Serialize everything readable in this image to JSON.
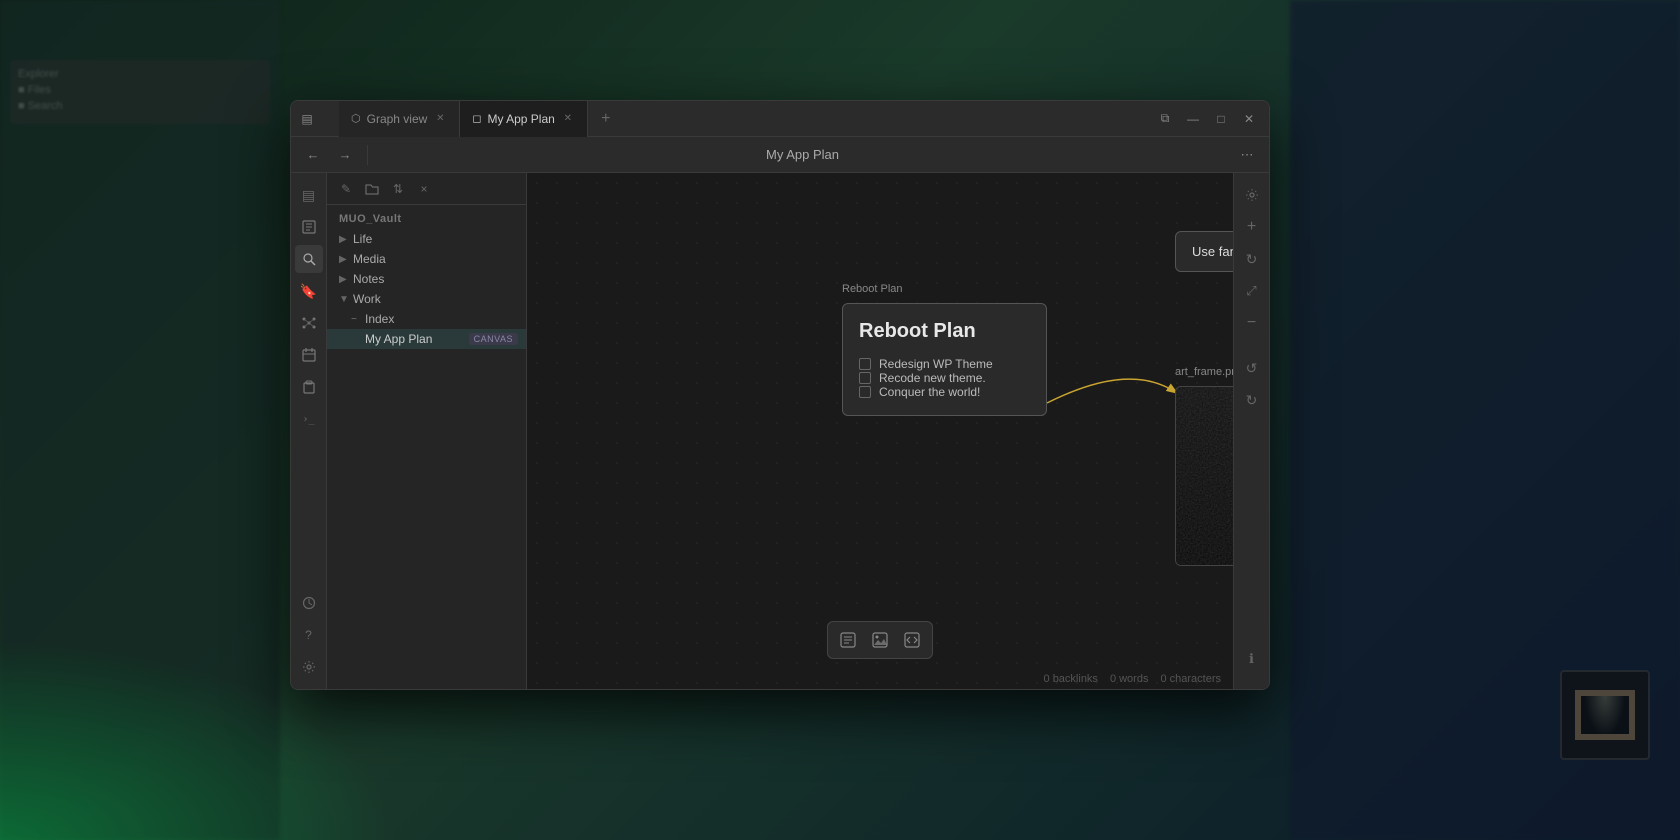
{
  "desktop": {
    "bg_color": "#1a3a2a"
  },
  "window": {
    "title": "My App Plan",
    "tabs": [
      {
        "id": "graph",
        "label": "Graph view",
        "icon": "⬡",
        "active": false
      },
      {
        "id": "canvas",
        "label": "My App Plan",
        "icon": "◻",
        "active": true
      }
    ],
    "tab_add_label": "+",
    "toolbar": {
      "back_label": "←",
      "forward_label": "→",
      "title": "My App Plan",
      "more_label": "⋯"
    },
    "win_controls": {
      "split": "⧉",
      "minimize": "—",
      "maximize": "□",
      "close": "✕"
    }
  },
  "sidebar_icons": [
    {
      "id": "sidebar-toggle",
      "icon": "▤",
      "title": "Toggle sidebar"
    },
    {
      "id": "files",
      "icon": "📁",
      "title": "Files"
    },
    {
      "id": "search",
      "icon": "🔍",
      "title": "Search"
    },
    {
      "id": "bookmark",
      "icon": "🔖",
      "title": "Bookmarks"
    },
    {
      "id": "graph-view",
      "icon": "⬡",
      "title": "Graph view"
    },
    {
      "id": "calendar",
      "icon": "📅",
      "title": "Calendar"
    },
    {
      "id": "clipboard",
      "icon": "📋",
      "title": "Clipboard"
    },
    {
      "id": "terminal",
      "icon": ">_",
      "title": "Terminal"
    }
  ],
  "sidebar_icons_bottom": [
    {
      "id": "publish",
      "icon": "☁",
      "title": "Publish"
    },
    {
      "id": "help",
      "icon": "?",
      "title": "Help"
    },
    {
      "id": "settings",
      "icon": "⚙",
      "title": "Settings"
    }
  ],
  "file_explorer": {
    "toolbar_buttons": [
      {
        "id": "new-note",
        "icon": "✎",
        "title": "New note"
      },
      {
        "id": "new-folder",
        "icon": "📁",
        "title": "New folder"
      },
      {
        "id": "sort",
        "icon": "⇅",
        "title": "Sort"
      },
      {
        "id": "collapse",
        "icon": "×",
        "title": "Collapse all"
      }
    ],
    "vault_name": "MUO_Vault",
    "tree": [
      {
        "id": "life",
        "label": "Life",
        "expanded": false,
        "indent": 0
      },
      {
        "id": "media",
        "label": "Media",
        "expanded": false,
        "indent": 0
      },
      {
        "id": "notes",
        "label": "Notes",
        "expanded": false,
        "indent": 0
      },
      {
        "id": "work",
        "label": "Work",
        "expanded": true,
        "indent": 0
      },
      {
        "id": "index",
        "label": "Index",
        "expanded": false,
        "indent": 1
      },
      {
        "id": "my-app-plan",
        "label": "My App Plan",
        "badge": "CANVAS",
        "active": true,
        "indent": 1
      }
    ]
  },
  "canvas": {
    "nodes": {
      "reboot_plan": {
        "label": "Reboot Plan",
        "title": "Reboot Plan",
        "checklist": [
          {
            "id": "wp",
            "text": "Redesign WP Theme",
            "checked": false
          },
          {
            "id": "recode",
            "text": "Recode new theme.",
            "checked": false
          },
          {
            "id": "world",
            "text": "Conquer the world!",
            "checked": false
          }
        ]
      },
      "fancy_bg": {
        "text": "Use fancy backgrounds!"
      },
      "image": {
        "label": "art_frame.png"
      }
    },
    "arrows": []
  },
  "right_panel_buttons": [
    {
      "id": "canvas-settings",
      "icon": "⚙"
    },
    {
      "id": "zoom-in",
      "icon": "+"
    },
    {
      "id": "refresh",
      "icon": "↻"
    },
    {
      "id": "fit",
      "icon": "⤢"
    },
    {
      "id": "zoom-out",
      "icon": "−"
    },
    {
      "id": "undo",
      "icon": "↺"
    },
    {
      "id": "redo",
      "icon": "↻"
    },
    {
      "id": "info",
      "icon": "ℹ"
    }
  ],
  "bottom_toolbar": [
    {
      "id": "add-note",
      "icon": "📄"
    },
    {
      "id": "add-media",
      "icon": "📋"
    },
    {
      "id": "add-embed",
      "icon": "🔗"
    }
  ],
  "status_bar": {
    "backlinks": "0 backlinks",
    "words": "0 words",
    "characters": "0 characters"
  }
}
